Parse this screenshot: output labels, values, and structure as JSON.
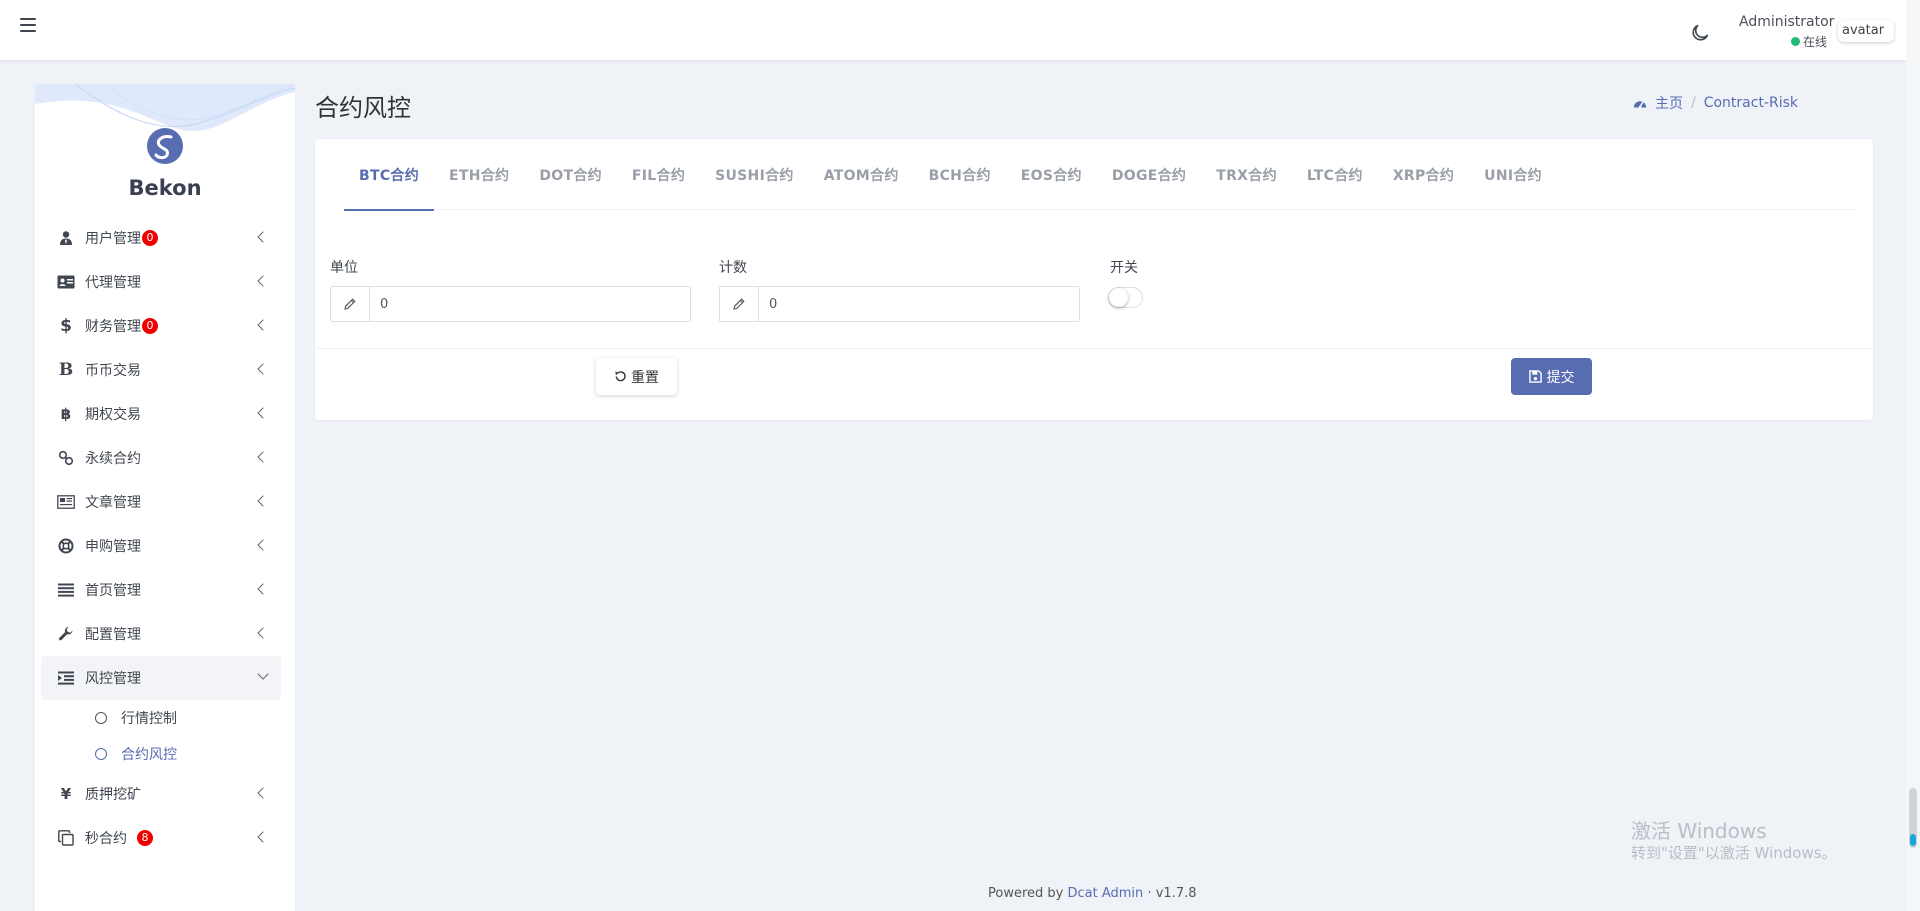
{
  "navbar": {
    "user_name": "Administrator",
    "user_status": "在线",
    "avatar_alt": "avatar",
    "status_color": "#21b978"
  },
  "sidebar": {
    "brand": "Bekon",
    "items": [
      {
        "label": "用户管理",
        "icon": "user-tie-icon",
        "badge": "0"
      },
      {
        "label": "代理管理",
        "icon": "id-card-icon"
      },
      {
        "label": "财务管理",
        "icon": "dollar-icon",
        "badge": "0"
      },
      {
        "label": "币币交易",
        "icon": "bold-b-icon"
      },
      {
        "label": "期权交易",
        "icon": "bitcoin-icon"
      },
      {
        "label": "永续合约",
        "icon": "link-icon"
      },
      {
        "label": "文章管理",
        "icon": "newspaper-icon"
      },
      {
        "label": "申购管理",
        "icon": "life-ring-icon"
      },
      {
        "label": "首页管理",
        "icon": "list-icon"
      },
      {
        "label": "配置管理",
        "icon": "wrench-icon"
      },
      {
        "label": "风控管理",
        "icon": "indent-icon",
        "expanded": true,
        "children": [
          {
            "label": "行情控制"
          },
          {
            "label": "合约风控",
            "current": true
          }
        ]
      },
      {
        "label": "质押挖矿",
        "icon": "yen-icon"
      },
      {
        "label": "秒合约",
        "icon": "copy-icon",
        "badge": "8"
      }
    ]
  },
  "page": {
    "title": "合约风控",
    "breadcrumb": {
      "home": "主页",
      "current": "Contract-Risk"
    }
  },
  "tabs": [
    "BTC合约",
    "ETH合约",
    "DOT合约",
    "FIL合约",
    "SUSHI合约",
    "ATOM合约",
    "BCH合约",
    "EOS合约",
    "DOGE合约",
    "TRX合约",
    "LTC合约",
    "XRP合约",
    "UNI合约"
  ],
  "active_tab": 0,
  "form": {
    "unit_label": "单位",
    "unit_value": "0",
    "count_label": "计数",
    "count_value": "0",
    "switch_label": "开关",
    "switch_on": false,
    "reset_label": "重置",
    "submit_label": "提交"
  },
  "watermark": {
    "title": "激活 Windows",
    "subtitle": "转到\"设置\"以激活 Windows。"
  },
  "footer": {
    "prefix": "Powered by",
    "link": "Dcat Admin",
    "separator": "·",
    "version": "v1.7.8"
  },
  "colors": {
    "accent": "#586cb1",
    "badge": "#ee0000"
  }
}
